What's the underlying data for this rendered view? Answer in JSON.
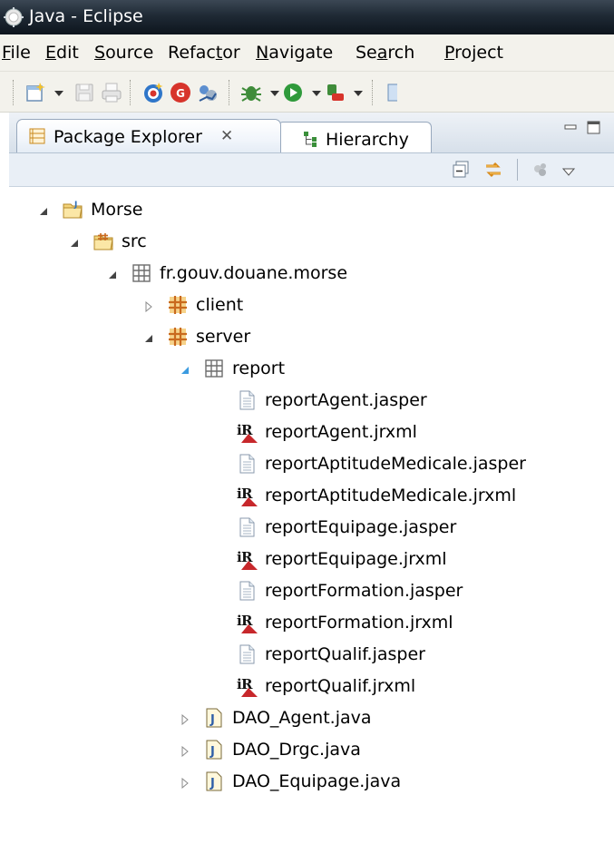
{
  "window": {
    "title": "Java - Eclipse"
  },
  "menu": [
    {
      "label": "File",
      "pre": "",
      "acc": "F",
      "post": "ile"
    },
    {
      "label": "Edit",
      "pre": "",
      "acc": "E",
      "post": "dit"
    },
    {
      "label": "Source",
      "pre": "",
      "acc": "S",
      "post": "ource"
    },
    {
      "label": "Refactor",
      "pre": "Refac",
      "acc": "t",
      "post": "or"
    },
    {
      "label": "Navigate",
      "pre": "",
      "acc": "N",
      "post": "avigate"
    },
    {
      "label": "Search",
      "pre": "Se",
      "acc": "a",
      "post": "rch"
    },
    {
      "label": "Project",
      "pre": "",
      "acc": "P",
      "post": "roject"
    }
  ],
  "toolbar": {
    "icons": [
      "new-wizard-icon",
      "dropdown-arrow-icon",
      "save-icon",
      "print-icon",
      "new-bookmark-icon",
      "gwt-icon",
      "ireport-icon",
      "debug-icon",
      "dropdown-arrow-icon",
      "run-icon",
      "dropdown-arrow-icon",
      "external-tools-icon",
      "dropdown-arrow-icon",
      "perspective-icon"
    ]
  },
  "view": {
    "tabs": [
      {
        "label": "Package Explorer",
        "close": "✕",
        "active": true,
        "icon": "package-explorer-icon"
      },
      {
        "label": "Hierarchy",
        "active": false,
        "icon": "hierarchy-icon"
      }
    ],
    "toolbar_icons": [
      "collapse-all-icon",
      "link-with-editor-icon",
      "filter-icon",
      "view-menu-icon"
    ]
  },
  "tree": {
    "items": [
      {
        "label": "Morse",
        "icon": "project-folder-icon",
        "twisty": "expanded"
      },
      {
        "label": "src",
        "icon": "source-folder-icon",
        "twisty": "expanded"
      },
      {
        "label": "fr.gouv.douane.morse",
        "icon": "empty-package-icon",
        "twisty": "expanded"
      },
      {
        "label": "client",
        "icon": "package-icon",
        "twisty": "collapsed"
      },
      {
        "label": "server",
        "icon": "package-icon",
        "twisty": "expanded"
      },
      {
        "label": "report",
        "icon": "empty-package-icon",
        "twisty": "expanded-selected"
      },
      {
        "label": "reportAgent.jasper",
        "icon": "file-icon",
        "twisty": "none"
      },
      {
        "label": "reportAgent.jrxml",
        "icon": "ireport-file-icon",
        "twisty": "none"
      },
      {
        "label": "reportAptitudeMedicale.jasper",
        "icon": "file-icon",
        "twisty": "none"
      },
      {
        "label": "reportAptitudeMedicale.jrxml",
        "icon": "ireport-file-icon",
        "twisty": "none"
      },
      {
        "label": "reportEquipage.jasper",
        "icon": "file-icon",
        "twisty": "none"
      },
      {
        "label": "reportEquipage.jrxml",
        "icon": "ireport-file-icon",
        "twisty": "none"
      },
      {
        "label": "reportFormation.jasper",
        "icon": "file-icon",
        "twisty": "none"
      },
      {
        "label": "reportFormation.jrxml",
        "icon": "ireport-file-icon",
        "twisty": "none"
      },
      {
        "label": "reportQualif.jasper",
        "icon": "file-icon",
        "twisty": "none"
      },
      {
        "label": "reportQualif.jrxml",
        "icon": "ireport-file-icon",
        "twisty": "none"
      },
      {
        "label": "DAO_Agent.java",
        "icon": "java-file-icon",
        "twisty": "collapsed"
      },
      {
        "label": "DAO_Drgc.java",
        "icon": "java-file-icon",
        "twisty": "collapsed"
      },
      {
        "label": "DAO_Equipage.java",
        "icon": "java-file-icon",
        "twisty": "collapsed"
      }
    ]
  },
  "colors": {
    "titlebar": "#1f2a35",
    "chrome": "#f3f2ec",
    "view_background": "#dfe6ee",
    "package_icon": "#c96a1e",
    "selection_twisty": "#3b9be0"
  }
}
